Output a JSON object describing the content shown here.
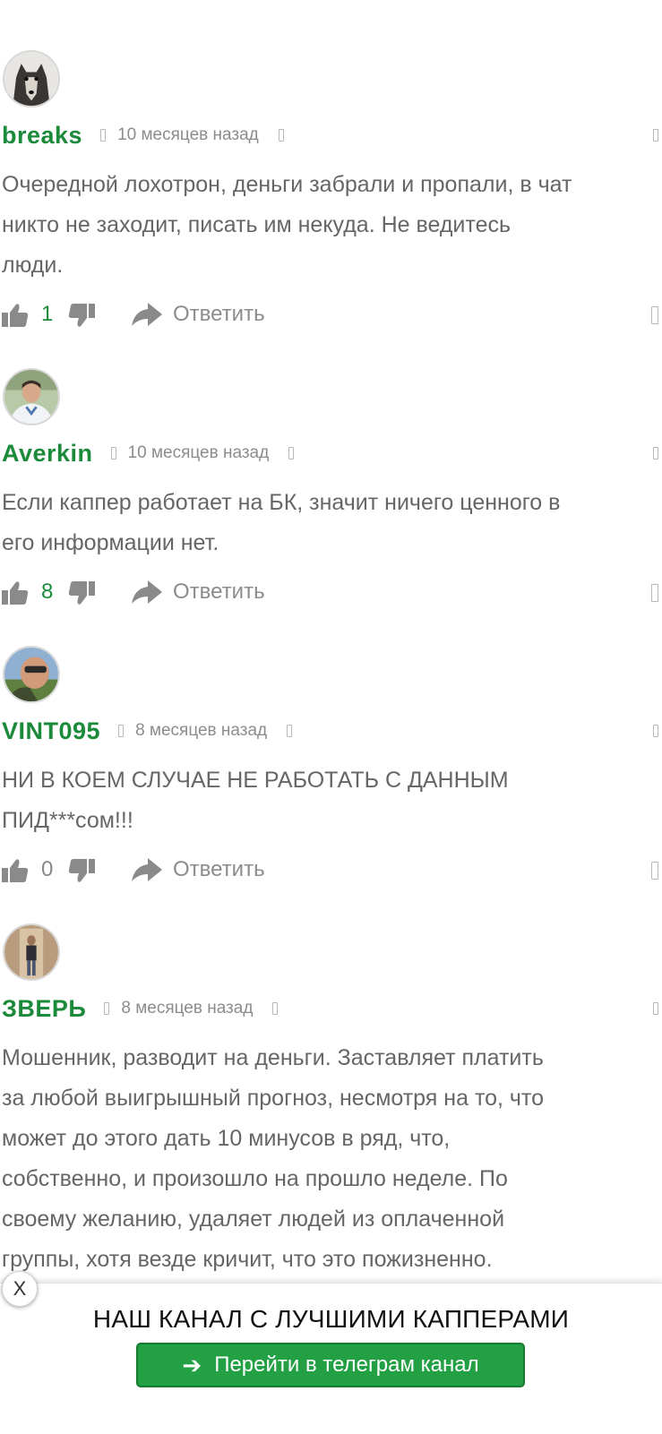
{
  "comments": [
    {
      "author": "breaks",
      "time": "10 месяцев назад",
      "text_lines": [
        "Очередной лохотрон, деньги забрали и пропали, в чат",
        "никто не заходит, писать им некуда. Не ведитесь",
        "люди."
      ],
      "votes": "1",
      "reply_label": "Ответить",
      "avatar_icon": "wolf-avatar"
    },
    {
      "author": "Averkin",
      "time": "10 месяцев назад",
      "text_lines": [
        "Если каппер работает на БК, значит ничего ценного в",
        "его информации нет."
      ],
      "votes": "8",
      "reply_label": "Ответить",
      "avatar_icon": "man-avatar"
    },
    {
      "author": "VINT095",
      "time": "8 месяцев назад",
      "text_lines": [
        "НИ В КОЕМ СЛУЧАЕ НЕ РАБОТАТЬ С ДАННЫМ",
        "ПИД***сом!!!"
      ],
      "votes": "0",
      "reply_label": "Ответить",
      "avatar_icon": "face-avatar"
    },
    {
      "author": "ЗВЕРЬ",
      "time": "8 месяцев назад",
      "text_lines": [
        "Мошенник, разводит на деньги. Заставляет платить",
        "за любой выигрышный прогноз, несмотря на то, что",
        "может до этого дать 10 минусов в ряд, что,",
        "собственно, и произошло на прошло неделе. По",
        "своему желанию, удаляет людей из оплаченной",
        "группы, хотя везде кричит, что это пожизненно."
      ],
      "reply_label": "Ответить",
      "avatar_icon": "doorway-avatar"
    }
  ],
  "cta": {
    "close_label": "X",
    "title": "НАШ КАНАЛ С ЛУЧШИМИ КАППЕРАМИ",
    "button_label": "Перейти в телеграм канал",
    "button_icon": "arrow-right-icon"
  },
  "colors": {
    "author": "#1b8a3a",
    "vote_positive": "#1b8a3a",
    "text": "#666666",
    "meta": "#8c8c8c",
    "button": "#22a043"
  }
}
